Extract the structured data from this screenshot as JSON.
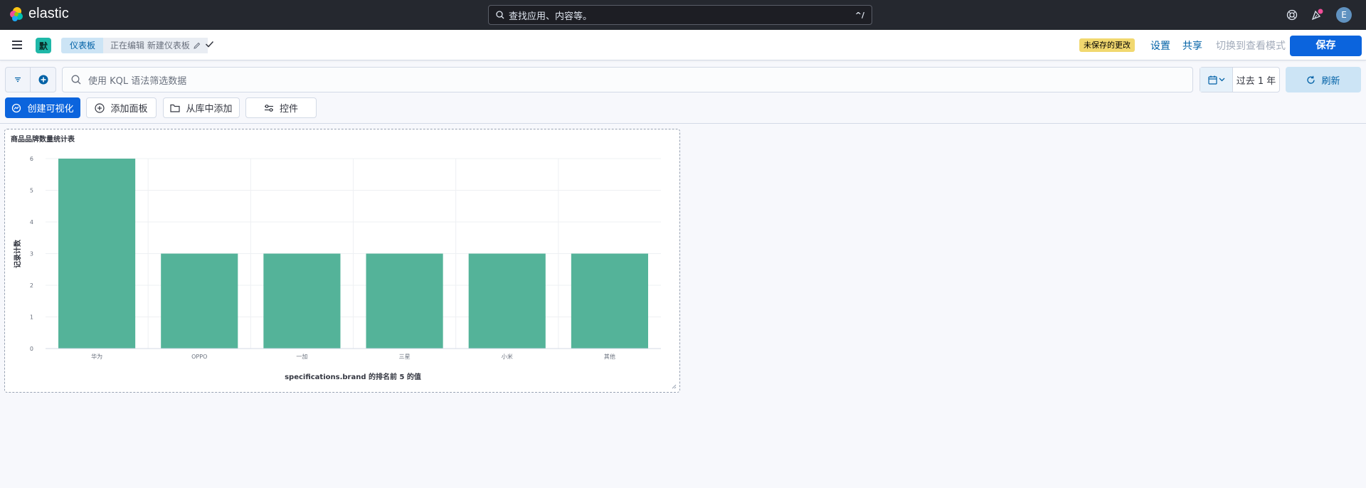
{
  "topbar": {
    "brand": "elastic",
    "search_placeholder": "查找应用、内容等。",
    "search_shortcut": "^/",
    "avatar_initial": "E"
  },
  "subbar": {
    "space_initial": "默",
    "crumb_dashboards": "仪表板",
    "crumb_editing": "正在编辑 新建仪表板",
    "unsaved_badge": "未保存的更改",
    "settings": "设置",
    "share": "共享",
    "switch_view": "切换到查看模式",
    "save": "保存"
  },
  "filterbar": {
    "kql_placeholder": "使用 KQL 语法筛选数据",
    "time_range": "过去 1 年",
    "refresh": "刷新"
  },
  "toolbar": {
    "create_visualization": "创建可视化",
    "add_panel": "添加面板",
    "add_from_library": "从库中添加",
    "controls": "控件"
  },
  "panel": {
    "title": "商品品牌数量统计表"
  },
  "colors": {
    "bar": "#54b399",
    "primary": "#0b64dd",
    "topbar": "#25282f"
  },
  "chart_data": {
    "type": "bar",
    "categories": [
      "华为",
      "OPPO",
      "一加",
      "三星",
      "小米",
      "其他"
    ],
    "values": [
      6,
      3,
      3,
      3,
      3,
      3
    ],
    "xlabel": "specifications.brand 的排名前 5 的值",
    "ylabel": "记录计数",
    "ylim": [
      0,
      6
    ],
    "yticks": [
      0,
      1,
      2,
      3,
      4,
      5,
      6
    ],
    "grid": true
  }
}
